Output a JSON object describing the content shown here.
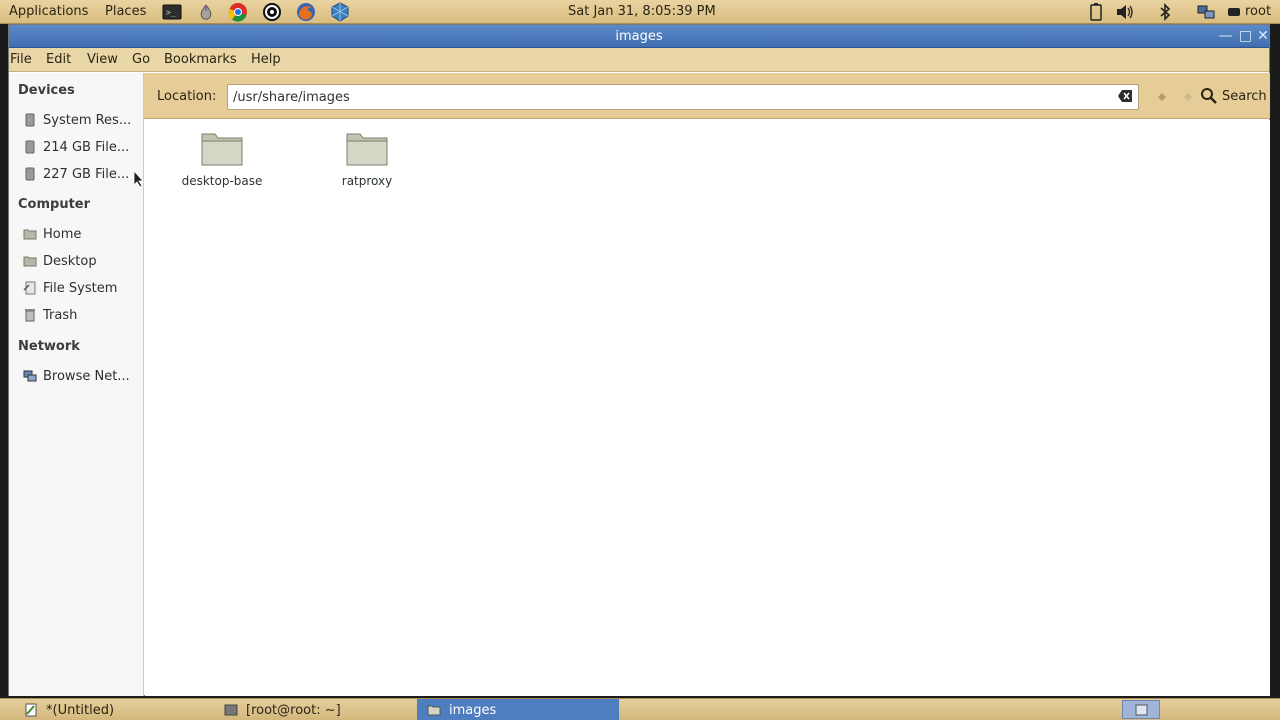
{
  "top_panel": {
    "applications": "Applications",
    "places": "Places",
    "clock": "Sat Jan 31,  8:05:39 PM",
    "user": "root"
  },
  "window": {
    "title": "images"
  },
  "menubar": {
    "items": [
      "File",
      "Edit",
      "View",
      "Go",
      "Bookmarks",
      "Help"
    ]
  },
  "sidebar": {
    "devices_header": "Devices",
    "devices": [
      "System Res...",
      "214 GB File...",
      "227 GB File..."
    ],
    "computer_header": "Computer",
    "computer": [
      "Home",
      "Desktop",
      "File System",
      "Trash"
    ],
    "network_header": "Network",
    "network": [
      "Browse Net..."
    ]
  },
  "locationbar": {
    "label": "Location:",
    "path": "/usr/share/images",
    "search_label": "Search"
  },
  "content": {
    "folders": [
      "desktop-base",
      "ratproxy"
    ]
  },
  "taskbar": {
    "tasks": [
      "*(Untitled)",
      "[root@root: ~]",
      "images"
    ]
  },
  "colors": {
    "panel": "#e2c98f",
    "titlebar": "#4a78ba",
    "task_active": "#4f7ec0"
  }
}
